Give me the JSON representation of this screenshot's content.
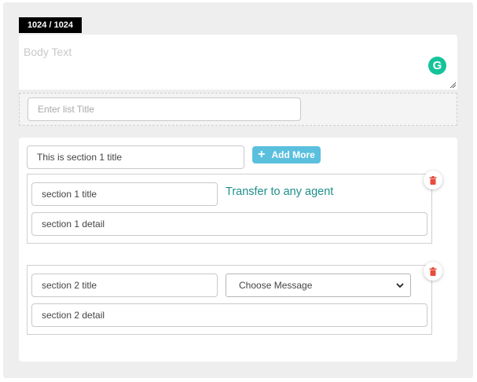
{
  "counter": "1024 / 1024",
  "body_text": {
    "placeholder": "Body Text"
  },
  "grammarly": {
    "letter": "G",
    "color": "#15c39a"
  },
  "list_title": {
    "placeholder": "Enter list Title"
  },
  "section_list": {
    "section1_title_value": "This is section 1 title",
    "add_more_label": "Add More",
    "accent_color": "#5bc0de",
    "sections": [
      {
        "title": "section 1 title",
        "detail": "section 1 detail",
        "action_text": "Transfer to any agent"
      },
      {
        "title": "section 2 title",
        "detail": "section 2 detail",
        "select_value": "Choose Message"
      }
    ]
  },
  "icons": {
    "delete": "trash-icon",
    "add": "plus-icon",
    "select": "chevron-down-icon"
  },
  "colors": {
    "delete_icon": "#e74c3c",
    "transfer_text": "#1f8f8a"
  }
}
